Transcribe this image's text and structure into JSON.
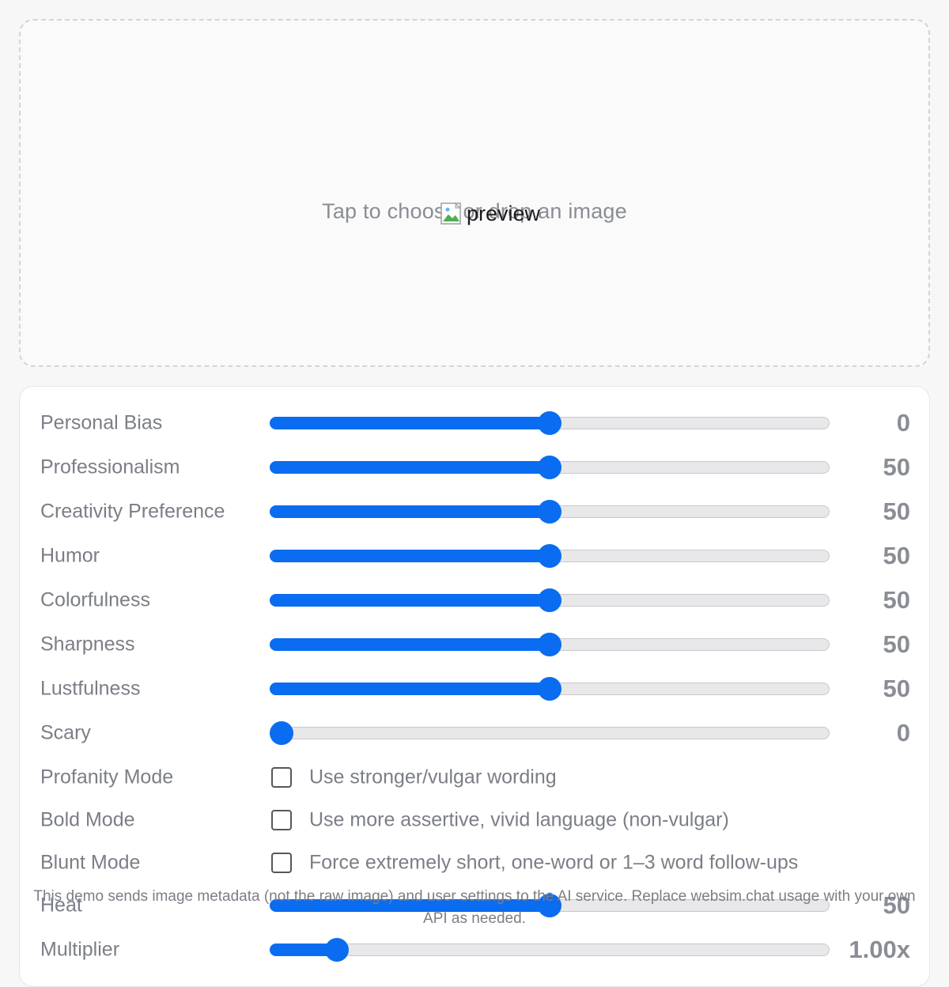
{
  "upload": {
    "hint": "Tap to choose or drop an image",
    "preview_alt": "preview"
  },
  "sliders": [
    {
      "label": "Personal Bias",
      "value": "0",
      "level": 0.5
    },
    {
      "label": "Professionalism",
      "value": "50",
      "level": 0.5
    },
    {
      "label": "Creativity Preference",
      "value": "50",
      "level": 0.5
    },
    {
      "label": "Humor",
      "value": "50",
      "level": 0.5
    },
    {
      "label": "Colorfulness",
      "value": "50",
      "level": 0.5
    },
    {
      "label": "Sharpness",
      "value": "50",
      "level": 0.5
    },
    {
      "label": "Lustfulness",
      "value": "50",
      "level": 0.5
    },
    {
      "label": "Scary",
      "value": "0",
      "level": 0.0
    }
  ],
  "toggles": [
    {
      "label": "Profanity Mode",
      "description": "Use stronger/vulgar wording",
      "checked": false
    },
    {
      "label": "Bold Mode",
      "description": "Use more assertive, vivid language (non-vulgar)",
      "checked": false
    },
    {
      "label": "Blunt Mode",
      "description": "Force extremely short, one-word or 1–3 word follow-ups",
      "checked": false
    }
  ],
  "extra_sliders": [
    {
      "label": "Heat",
      "value": "50",
      "level": 0.5
    },
    {
      "label": "Multiplier",
      "value": "1.00x",
      "level": 0.12
    }
  ],
  "footer_note": "This demo sends image metadata (not the raw image) and user settings to the AI service. Replace websim.chat usage with your own API as needed.",
  "colors": {
    "accent": "#0a6cf0",
    "track": "#e8e8ea",
    "muted_text": "#7b7e86"
  }
}
